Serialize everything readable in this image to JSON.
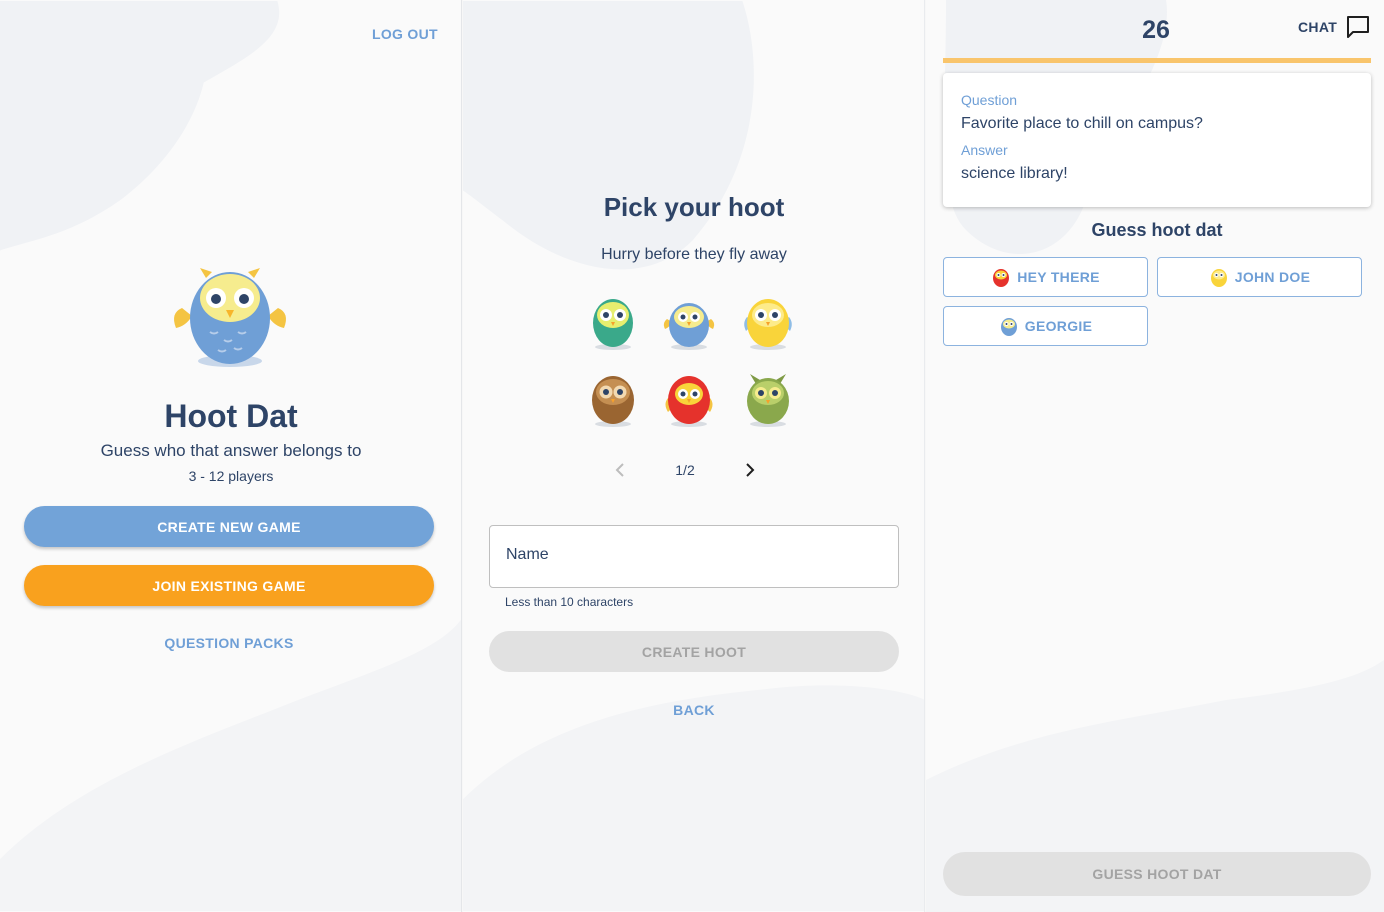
{
  "home": {
    "logout_label": "LOG OUT",
    "title": "Hoot Dat",
    "subtitle": "Guess who that answer belongs to",
    "players": "3 - 12 players",
    "create_label": "CREATE NEW GAME",
    "join_label": "JOIN EXISTING GAME",
    "packs_label": "QUESTION PACKS"
  },
  "pick": {
    "title": "Pick your hoot",
    "subtitle": "Hurry before they fly away",
    "owls": [
      "green-owl-icon",
      "blue-owl-icon",
      "yellow-owl-icon",
      "brown-owl-icon",
      "red-owl-icon",
      "olive-owl-icon"
    ],
    "pager": "1/2",
    "name_label": "Name",
    "name_helper": "Less than 10 characters",
    "create_label": "CREATE HOOT",
    "back_label": "BACK"
  },
  "guess": {
    "timer": "26",
    "chat_label": "CHAT",
    "progress": 1.0,
    "question_label": "Question",
    "question": "Favorite place to chill on campus?",
    "answer_label": "Answer",
    "answer": "science library!",
    "heading": "Guess hoot dat",
    "players": [
      {
        "name": "HEY THERE",
        "owl": "red-owl-icon"
      },
      {
        "name": "JOHN DOE",
        "owl": "yellow-owl-icon"
      },
      {
        "name": "GEORGIE",
        "owl": "blue-owl-icon"
      }
    ],
    "submit_label": "GUESS HOOT DAT"
  },
  "colors": {
    "primary_blue": "#72a3d8",
    "orange": "#f9a11e",
    "navy_text": "#2e4467",
    "link_blue": "#6f9fd6",
    "disabled": "#e1e1e1"
  }
}
